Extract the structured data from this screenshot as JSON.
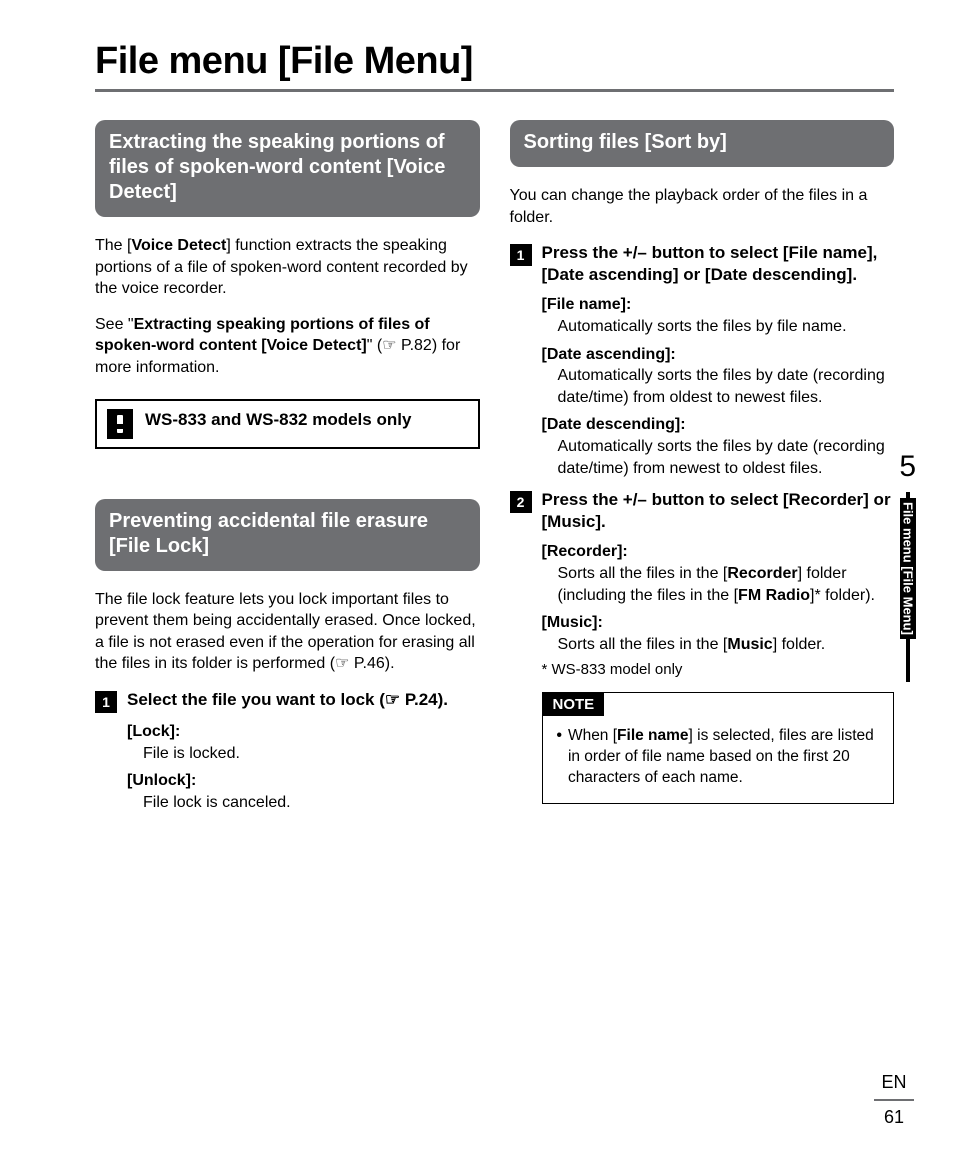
{
  "page": {
    "title": "File menu [File Menu]",
    "chapter": "5",
    "side_label": "File menu [File Menu]",
    "lang": "EN",
    "number": "61"
  },
  "left": {
    "sec1": {
      "heading": "Extracting the speaking portions of files of spoken-word content [Voice Detect]",
      "p1a": "The [",
      "p1b": "Voice Detect",
      "p1c": "] function extracts the speaking portions of a file of spoken-word content recorded by the voice recorder.",
      "p2a": "See \"",
      "p2b": "Extracting speaking portions of files of spoken-word content [Voice Detect]",
      "p2c": "\" (☞ P.82) for more information.",
      "alert": "WS-833 and WS-832 models only"
    },
    "sec2": {
      "heading": "Preventing accidental file erasure [File Lock]",
      "p1": "The file lock feature lets you lock important files to prevent them being accidentally erased. Once locked, a file is not erased even if the operation for erasing all the files in its folder is performed (☞ P.46).",
      "step1": {
        "num": "1",
        "text": "Select the file you want to lock (☞ P.24).",
        "opt1_label": "Lock",
        "opt1_desc": "File is locked.",
        "opt2_label": "Unlock",
        "opt2_desc": "File lock is canceled."
      }
    }
  },
  "right": {
    "sec3": {
      "heading": "Sorting files [Sort by]",
      "p1": "You can change the playback order of the files in a folder.",
      "step1": {
        "num": "1",
        "t1": "Press the +/– button to select [",
        "m1": "File name",
        "t2": "], [",
        "m2": "Date ascending",
        "t3": "] or [",
        "m3": "Date descending",
        "t4": "].",
        "o1_label": "File name",
        "o1_desc": "Automatically sorts the files by file name.",
        "o2_label": "Date ascending",
        "o2_desc": "Automatically sorts the files by date (recording date/time) from oldest to newest files.",
        "o3_label": "Date descending",
        "o3_desc": "Automatically sorts the files by date (recording date/time) from newest to oldest files."
      },
      "step2": {
        "num": "2",
        "t1": "Press the +/– button to select [",
        "m1": "Recorder",
        "t2": "] or [",
        "m2": "Music",
        "t3": "].",
        "o1_label": "Recorder",
        "o1_d1": "Sorts all the files in the [",
        "o1_b1": "Recorder",
        "o1_d2": "] folder (including the files in the [",
        "o1_b2": "FM Radio",
        "o1_d3": "]* folder).",
        "o2_label": "Music",
        "o2_d1": "Sorts all the files in the [",
        "o2_b1": "Music",
        "o2_d2": "] folder.",
        "foot": "* WS-833 model only"
      },
      "note": {
        "head": "NOTE",
        "b1a": "When [",
        "b1b": "File name",
        "b1c": "] is selected, files are listed in order of file name based on the first 20 characters of each name."
      }
    }
  }
}
